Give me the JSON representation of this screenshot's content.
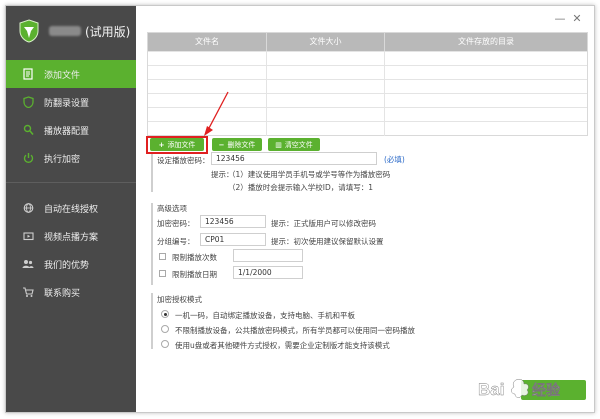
{
  "app": {
    "title_suffix": "(试用版)"
  },
  "window_controls": {
    "minimize": "—",
    "close": "✕"
  },
  "sidebar": {
    "items": [
      {
        "label": "添加文件",
        "icon": "add-file-icon",
        "active": true
      },
      {
        "label": "防翻录设置",
        "icon": "shield-icon",
        "active": false
      },
      {
        "label": "播放器配置",
        "icon": "search-icon",
        "active": false
      },
      {
        "label": "执行加密",
        "icon": "power-icon",
        "active": false
      },
      {
        "label": "自动在线授权",
        "icon": "globe-icon",
        "active": false
      },
      {
        "label": "视频点播方案",
        "icon": "video-icon",
        "active": false
      },
      {
        "label": "我们的优势",
        "icon": "users-icon",
        "active": false
      },
      {
        "label": "联系购买",
        "icon": "cart-icon",
        "active": false
      }
    ]
  },
  "file_table": {
    "columns": [
      "文件名",
      "文件大小",
      "文件存放的目录"
    ],
    "rows": []
  },
  "toolbar": {
    "add_label": "添加文件",
    "delete_label": "删除文件",
    "clear_label": "清空文件"
  },
  "password": {
    "label": "设定播放密码：",
    "value": "123456",
    "link": "(必填)",
    "hint_prefix": "提示：",
    "hint1": "（1）建议使用学员手机号或学号等作为播放密码",
    "hint2": "（2）播放时会提示输入学校ID，请填写：1"
  },
  "advanced": {
    "title": "高级选项",
    "encrypt_label": "加密密码：",
    "encrypt_value": "123456",
    "encrypt_hint": "提示：正式版用户可以修改密码",
    "group_label": "分组编号：",
    "group_value": "CP01",
    "group_hint": "提示：初次使用建议保留默认设置",
    "limit_count_label": "限制播放次数",
    "limit_date_label": "限制播放日期",
    "limit_date_value": "1/1/2000"
  },
  "auth_mode": {
    "title": "加密授权模式",
    "options": [
      {
        "label": "一机一码，自动绑定播放设备，支持电脑、手机和平板",
        "selected": true
      },
      {
        "label": "不限制播放设备，公共播放密码模式，所有学员都可以使用同一密码播放",
        "selected": false
      },
      {
        "label": "使用u盘或者其他硬件方式授权，需要企业定制版才能支持该模式",
        "selected": false
      }
    ]
  },
  "watermark": {
    "text": "Bai",
    "brand": "经验"
  },
  "colors": {
    "accent": "#5bb12f",
    "sidebar": "#494949",
    "header": "#b9b9b9",
    "highlight": "#e02020",
    "link": "#2a69c8"
  }
}
